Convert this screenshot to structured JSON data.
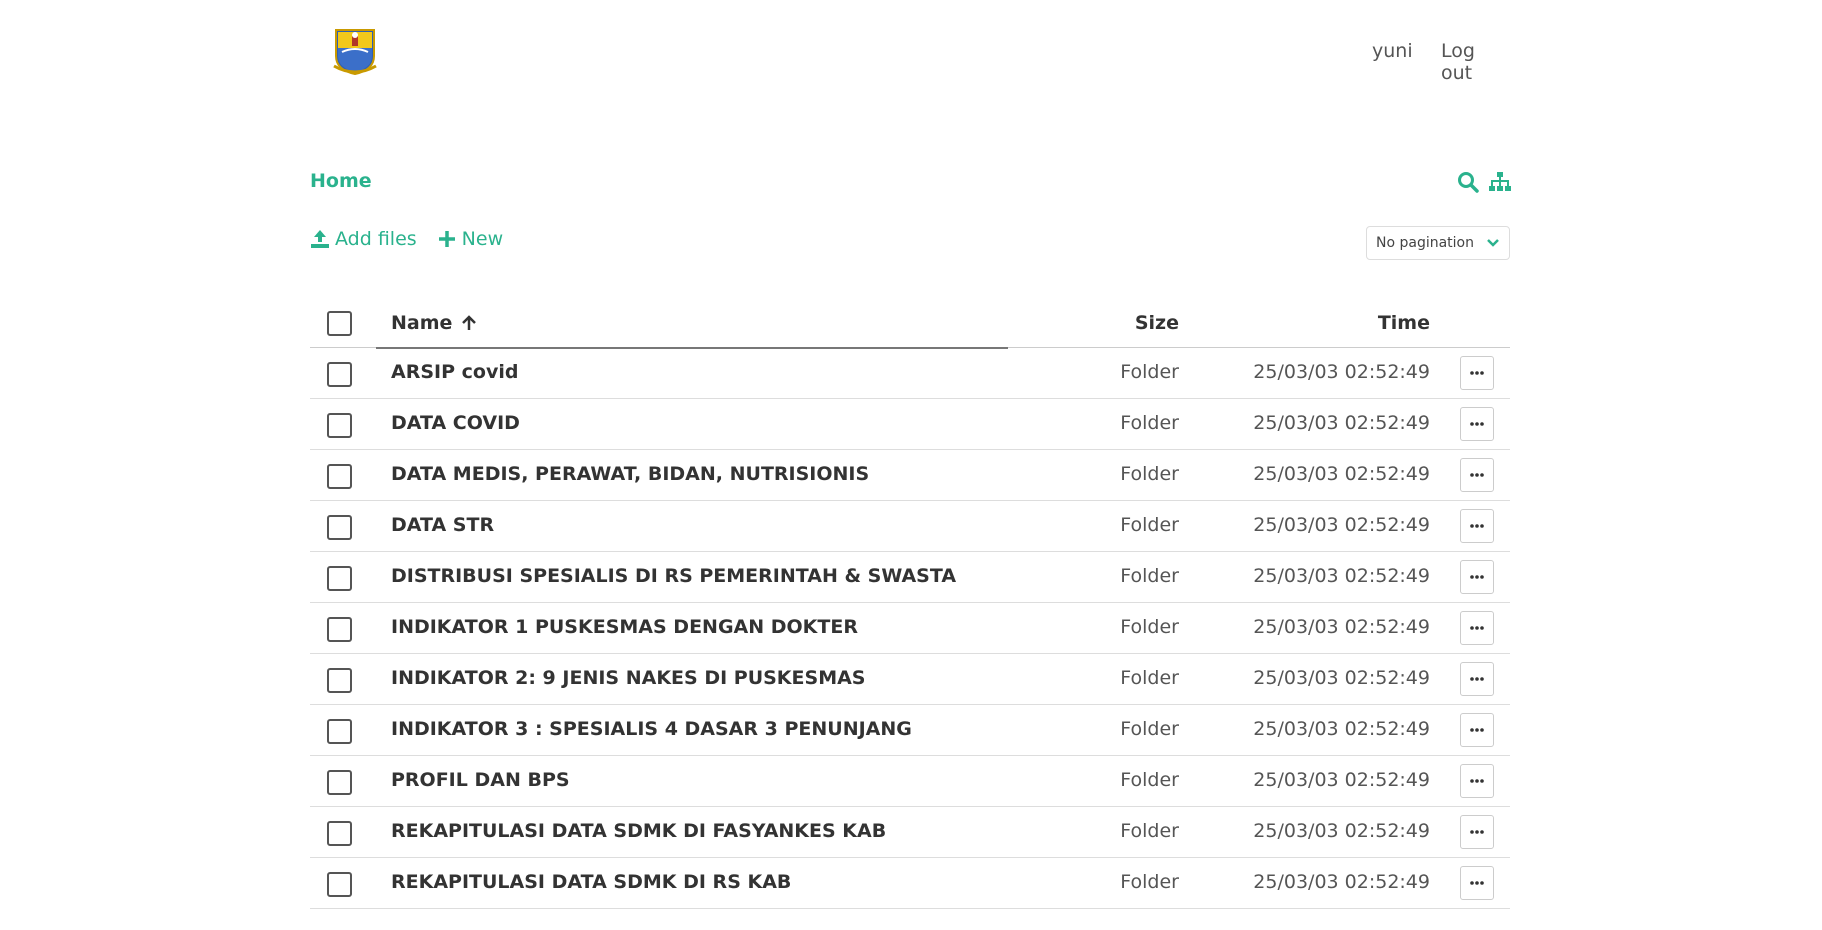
{
  "header": {
    "user_name": "yuni",
    "logout_label": "Log out"
  },
  "breadcrumb": {
    "home_label": "Home"
  },
  "toolbar": {
    "add_files_label": "Add files",
    "new_label": "New",
    "pagination_label": "No pagination"
  },
  "table": {
    "columns": {
      "name": "Name",
      "size": "Size",
      "time": "Time"
    },
    "rows": [
      {
        "name": "ARSIP covid",
        "size": "Folder",
        "time": "25/03/03 02:52:49"
      },
      {
        "name": "DATA COVID",
        "size": "Folder",
        "time": "25/03/03 02:52:49"
      },
      {
        "name": "DATA MEDIS, PERAWAT, BIDAN, NUTRISIONIS",
        "size": "Folder",
        "time": "25/03/03 02:52:49"
      },
      {
        "name": "DATA STR",
        "size": "Folder",
        "time": "25/03/03 02:52:49"
      },
      {
        "name": "DISTRIBUSI SPESIALIS DI RS PEMERINTAH & SWASTA",
        "size": "Folder",
        "time": "25/03/03 02:52:49"
      },
      {
        "name": "INDIKATOR 1 PUSKESMAS DENGAN DOKTER",
        "size": "Folder",
        "time": "25/03/03 02:52:49"
      },
      {
        "name": "INDIKATOR 2: 9 JENIS NAKES DI PUSKESMAS",
        "size": "Folder",
        "time": "25/03/03 02:52:49"
      },
      {
        "name": "INDIKATOR 3 : SPESIALIS 4 DASAR 3 PENUNJANG",
        "size": "Folder",
        "time": "25/03/03 02:52:49"
      },
      {
        "name": "PROFIL DAN BPS",
        "size": "Folder",
        "time": "25/03/03 02:52:49"
      },
      {
        "name": "REKAPITULASI DATA SDMK DI FASYANKES KAB",
        "size": "Folder",
        "time": "25/03/03 02:52:49"
      },
      {
        "name": "REKAPITULASI DATA SDMK DI RS KAB",
        "size": "Folder",
        "time": "25/03/03 02:52:49"
      }
    ]
  },
  "colors": {
    "accent": "#2ab28d",
    "text": "#333333",
    "border": "#dddddd"
  },
  "icons": {
    "search": "search-icon",
    "sitemap": "sitemap-icon",
    "upload": "upload-icon",
    "plus": "plus-icon",
    "sort": "arrow-up-icon",
    "more": "more-icon",
    "chevron": "chevron-down-icon"
  }
}
